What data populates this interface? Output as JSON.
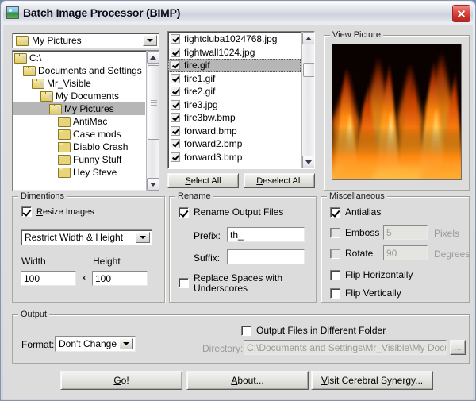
{
  "window": {
    "title": "Batch Image Processor (BIMP)",
    "app_icon": "picture-icon",
    "close_label": "×"
  },
  "browser": {
    "folder_combo": {
      "value": "My Pictures",
      "icon": "folder-icon",
      "arrow_icon": "chevron-down-icon"
    },
    "tree_items": [
      {
        "label": "C:\\",
        "depth": 0,
        "icon": "folder-open-icon",
        "selected": false
      },
      {
        "label": "Documents and Settings",
        "depth": 1,
        "icon": "folder-open-icon",
        "selected": false
      },
      {
        "label": "Mr_Visible",
        "depth": 2,
        "icon": "folder-open-icon",
        "selected": false
      },
      {
        "label": "My Documents",
        "depth": 3,
        "icon": "folder-open-icon",
        "selected": false
      },
      {
        "label": "My Pictures",
        "depth": 4,
        "icon": "folder-open-icon",
        "selected": true
      },
      {
        "label": "AntiMac",
        "depth": 5,
        "icon": "folder-icon",
        "selected": false
      },
      {
        "label": "Case mods",
        "depth": 5,
        "icon": "folder-icon",
        "selected": false
      },
      {
        "label": "Diablo Crash",
        "depth": 5,
        "icon": "folder-icon",
        "selected": false
      },
      {
        "label": "Funny Stuff",
        "depth": 5,
        "icon": "folder-icon",
        "selected": false
      },
      {
        "label": "Hey Steve",
        "depth": 5,
        "icon": "folder-icon",
        "selected": false
      }
    ]
  },
  "files": {
    "items": [
      {
        "name": "fightcluba1024768.jpg",
        "checked": true,
        "selected": false
      },
      {
        "name": "fightwall1024.jpg",
        "checked": true,
        "selected": false
      },
      {
        "name": "fire.gif",
        "checked": true,
        "selected": true
      },
      {
        "name": "fire1.gif",
        "checked": true,
        "selected": false
      },
      {
        "name": "fire2.gif",
        "checked": true,
        "selected": false
      },
      {
        "name": "fire3.jpg",
        "checked": true,
        "selected": false
      },
      {
        "name": "fire3bw.bmp",
        "checked": true,
        "selected": false
      },
      {
        "name": "forward.bmp",
        "checked": true,
        "selected": false
      },
      {
        "name": "forward2.bmp",
        "checked": true,
        "selected": false
      },
      {
        "name": "forward3.bmp",
        "checked": true,
        "selected": false
      }
    ],
    "select_all_label": "Select All",
    "select_all_accel": "S",
    "deselect_all_label": "Deselect All",
    "deselect_all_accel": "D"
  },
  "preview": {
    "legend": "View Picture",
    "image_alt": "fire flames photograph"
  },
  "dimensions": {
    "legend": "Dimentions",
    "resize_label": "Resize Images",
    "resize_accel": "R",
    "resize_checked": true,
    "mode_value": "Restrict Width & Height",
    "width_label": "Width",
    "width_value": "100",
    "times_label": "x",
    "height_label": "Height",
    "height_value": "100"
  },
  "rename": {
    "legend": "Rename",
    "rename_label": "Rename Output Files",
    "rename_checked": true,
    "prefix_label": "Prefix:",
    "prefix_value": "th_",
    "suffix_label": "Suffix:",
    "suffix_value": "",
    "replace_label_line1": "Replace Spaces with",
    "replace_label_line2": "Underscores",
    "replace_checked": false
  },
  "misc": {
    "legend": "Miscellaneous",
    "antialias_label": "Antialias",
    "antialias_checked": true,
    "emboss_label": "Emboss",
    "emboss_checked": false,
    "emboss_value": "5",
    "emboss_unit": "Pixels",
    "rotate_label": "Rotate",
    "rotate_checked": false,
    "rotate_value": "90",
    "rotate_unit": "Degrees",
    "flip_h_label": "Flip Horizontally",
    "flip_h_checked": false,
    "flip_v_label": "Flip Vertically",
    "flip_v_checked": false
  },
  "output": {
    "legend": "Output",
    "format_label": "Format:",
    "format_value": "Don't Change",
    "different_folder_label": "Output Files in Different Folder",
    "different_folder_checked": false,
    "directory_label": "Directory:",
    "directory_value": "C:\\Documents and Settings\\Mr_Visible\\My Documents\\M",
    "browse_label": "..."
  },
  "actions": {
    "go_label": "Go!",
    "go_accel": "G",
    "about_label": "About...",
    "about_accel": "A",
    "visit_label": "Visit Cerebral Synergy...",
    "visit_accel": "V"
  },
  "colors": {
    "accent_close": "#c8302a",
    "dialog_bg": "#dcdcdc",
    "selection": "#b6b6b6",
    "flame_orange": "#ff7a10",
    "flame_yellow": "#ffd25a"
  }
}
